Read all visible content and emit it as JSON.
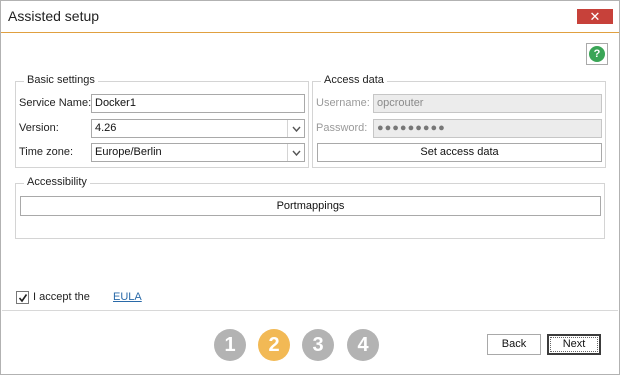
{
  "window": {
    "title": "Assisted setup",
    "close_glyph": "✕"
  },
  "help": {
    "icon": "help-icon",
    "glyph": "?"
  },
  "basic_settings": {
    "legend": "Basic settings",
    "service_name_label": "Service Name:",
    "service_name_value": "Docker1",
    "version_label": "Version:",
    "version_value": "4.26",
    "timezone_label": "Time zone:",
    "timezone_value": "Europe/Berlin"
  },
  "access_data": {
    "legend": "Access data",
    "username_label": "Username:",
    "username_value": "opcrouter",
    "password_label": "Password:",
    "password_value": "●●●●●●●●●",
    "set_button": "Set access data"
  },
  "accessibility": {
    "legend": "Accessibility",
    "portmappings_button": "Portmappings"
  },
  "eula": {
    "checked": true,
    "label": "I accept the",
    "link": "EULA"
  },
  "steps": {
    "items": [
      "1",
      "2",
      "3",
      "4"
    ],
    "active": 2,
    "active_color": "#f2b955",
    "inactive_color": "#b3b3b3"
  },
  "footer": {
    "back_label": "Back",
    "next_label": "Next"
  },
  "colors": {
    "accent": "#e0a040",
    "close": "#c7413a",
    "help": "#3aa556",
    "link": "#2a6aa8"
  }
}
